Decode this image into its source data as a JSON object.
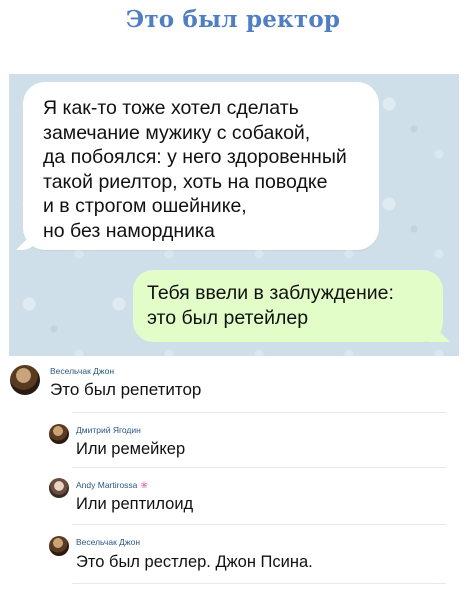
{
  "title": "Это был ректор",
  "chat": {
    "incoming_lines": [
      "Я как-то тоже хотел сделать",
      "замечание мужику с собакой,",
      "да побоялся: у него здоровенный",
      "такой риелтор, хоть на поводке",
      "и в строгом ошейнике,",
      "но без намордника"
    ],
    "outgoing_lines": [
      "Тебя ввели в заблуждение:",
      "это был ретейлер"
    ]
  },
  "comments": [
    {
      "author": "Весельчак Джон",
      "text": "Это был репетитор"
    },
    {
      "author": "Дмитрий Ягодин",
      "text": "Или ремейкер"
    },
    {
      "author": "Andy Martirossa",
      "text": "Или рептилоид",
      "author_icon": "flower-icon"
    },
    {
      "author": "Весельчак Джон",
      "text": "Это был рестлер. Джон Псина."
    }
  ]
}
